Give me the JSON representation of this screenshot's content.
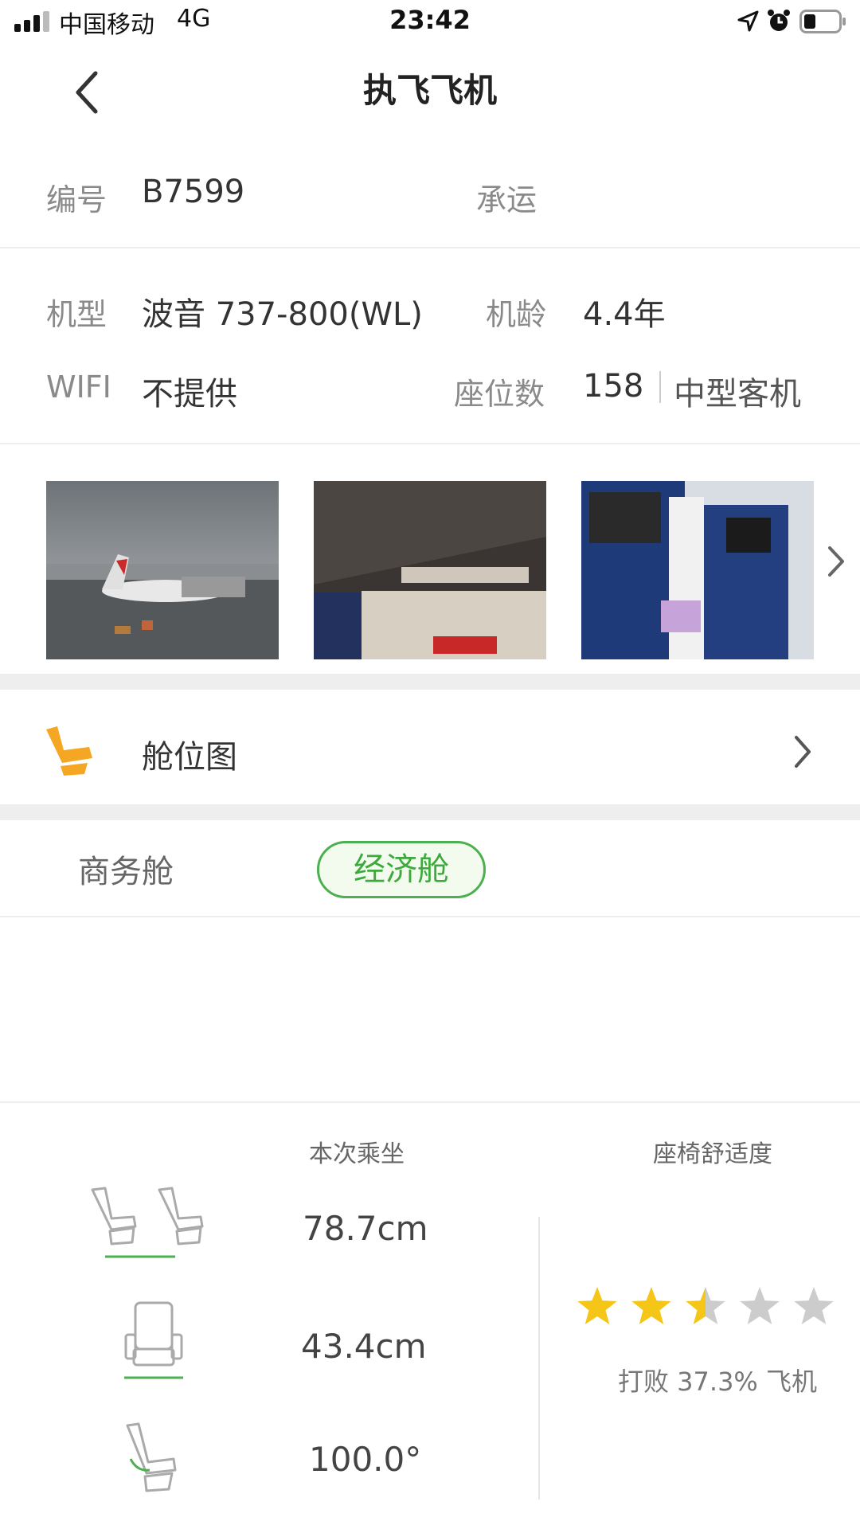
{
  "status_bar": {
    "carrier": "中国移动",
    "network": "4G",
    "time": "23:42"
  },
  "nav": {
    "title": "执飞飞机"
  },
  "info": {
    "reg_label": "编号",
    "reg_value": "B7599",
    "carrier_label": "承运",
    "type_label": "机型",
    "type_value": "波音 737-800(WL)",
    "age_label": "机龄",
    "age_value": "4.4年",
    "wifi_label": "WIFI",
    "wifi_value": "不提供",
    "seats_label": "座位数",
    "seats_value": "158",
    "size_value": "中型客机"
  },
  "seatmap": {
    "label": "舱位图"
  },
  "cabin_tabs": {
    "business": "商务舱",
    "economy": "经济舱",
    "selected": "经济舱"
  },
  "comfort": {
    "this_flight_header": "本次乘坐",
    "rating_header": "座椅舒适度",
    "pitch": "78.7cm",
    "width": "43.4cm",
    "recline": "100.0°",
    "rating_stars": 2.5,
    "rating_max": 5,
    "beat_text": "打败 37.3% 飞机"
  },
  "colors": {
    "accent_green": "#4caf50",
    "star_yellow": "#f5c518",
    "star_gray": "#cccccc",
    "seat_orange": "#f5a623"
  }
}
